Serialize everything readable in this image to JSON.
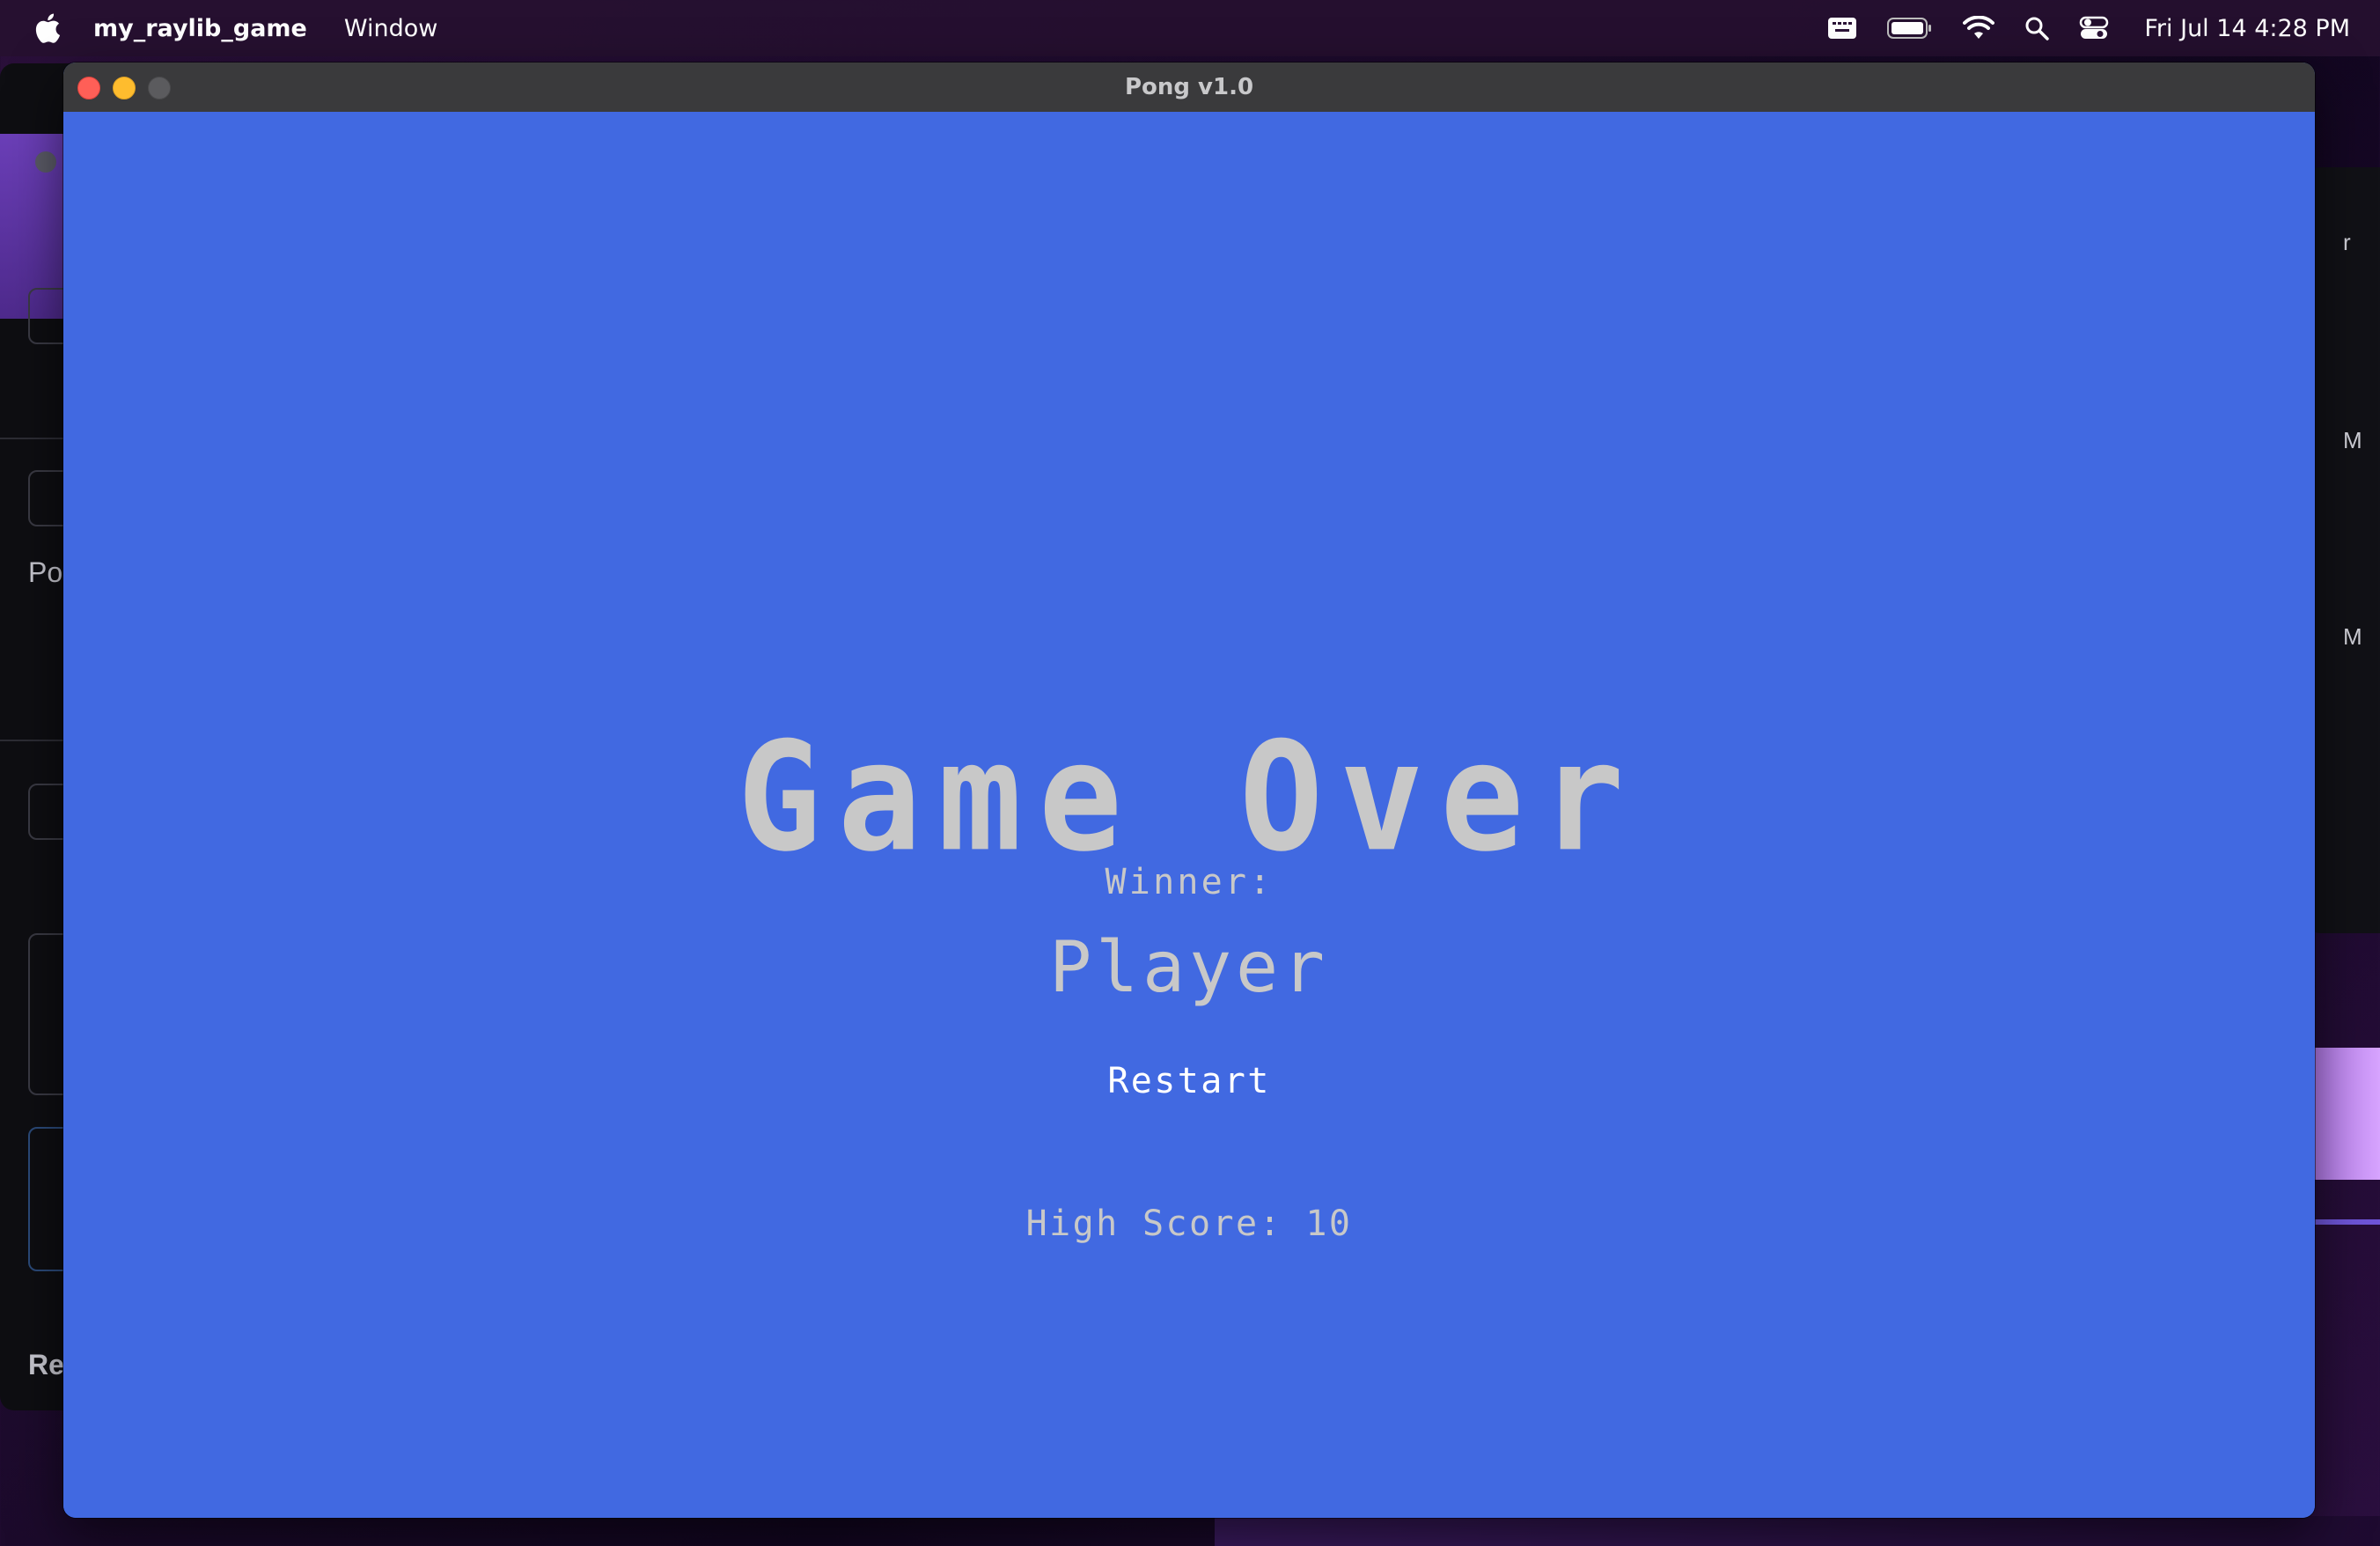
{
  "menubar": {
    "app_name": "my_raylib_game",
    "items": [
      "Window"
    ],
    "clock": "Fri Jul 14  4:28 PM"
  },
  "background": {
    "left_window_text": "Po",
    "left_window_bottom_text": "Re",
    "right_window_texts": [
      "r",
      "M",
      "M"
    ]
  },
  "window": {
    "title": "Pong v1.0"
  },
  "game": {
    "title": "Game Over",
    "winner_label": "Winner:",
    "winner_name": "Player",
    "restart_label": "Restart",
    "high_score": "High Score: 10"
  },
  "colors": {
    "game_background": "#4169e1",
    "text_gray": "#c8c8c8",
    "restart_text": "#ffffff",
    "titlebar": "#3a3a3c"
  }
}
